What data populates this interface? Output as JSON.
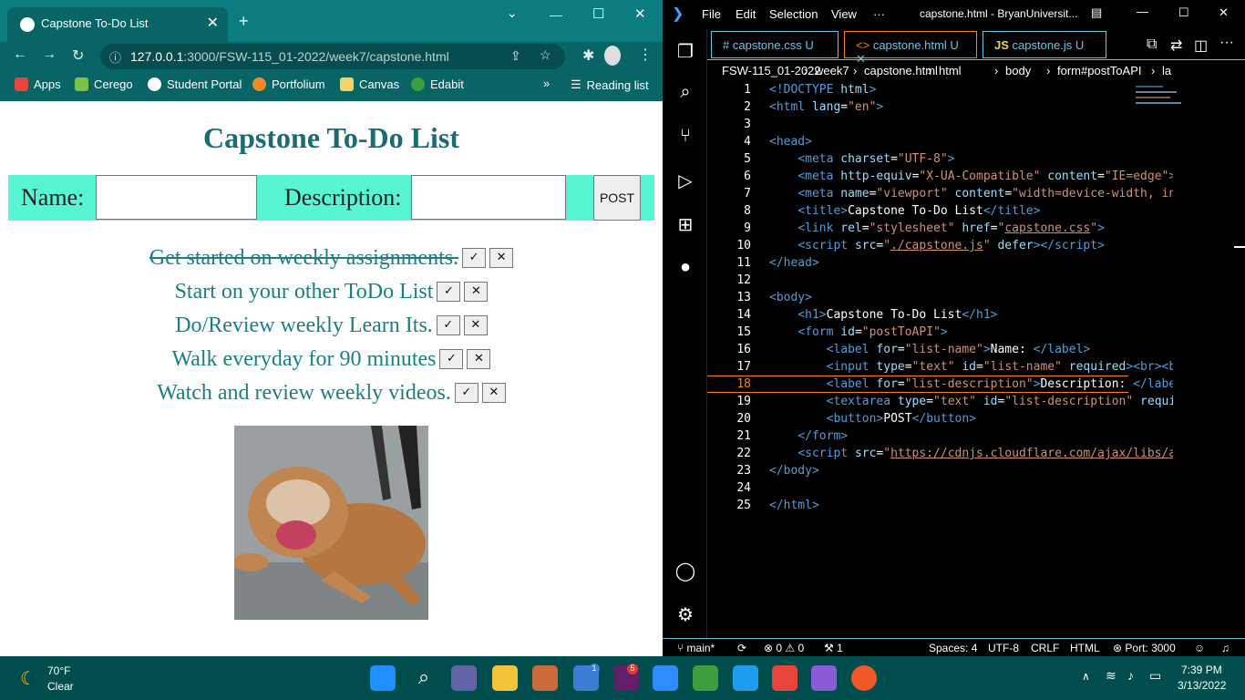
{
  "browser": {
    "tab_title": "Capstone To-Do List",
    "url_host": "127.0.0.1",
    "url_rest": ":3000/FSW-115_01-2022/week7/capstone.html",
    "bookmarks": [
      "Apps",
      "Cerego",
      "Student Portal",
      "Portfolium",
      "Canvas",
      "Edabit"
    ],
    "reading_list": "Reading list"
  },
  "page": {
    "title": "Capstone To-Do List",
    "name_label": "Name:",
    "desc_label": "Description:",
    "post_label": "POST",
    "check_glyph": "✓",
    "delete_glyph": "✕",
    "items": [
      {
        "text": "Get started on weekly assignments.",
        "done": true
      },
      {
        "text": "Start on your other ToDo List",
        "done": false
      },
      {
        "text": "Do/Review weekly Learn Its.",
        "done": false
      },
      {
        "text": "Walk everyday for 90 minutes",
        "done": false
      },
      {
        "text": "Watch and review weekly videos.",
        "done": false
      }
    ]
  },
  "vscode": {
    "menu": [
      "File",
      "Edit",
      "Selection",
      "View",
      "···"
    ],
    "window_title": "capstone.html - BryanUniversit...",
    "tabs": [
      {
        "icon": "#",
        "name": "capstone.css",
        "badge": "U"
      },
      {
        "icon": "<>",
        "name": "capstone.html",
        "badge": "U"
      },
      {
        "icon": "JS",
        "name": "capstone.js",
        "badge": "U"
      }
    ],
    "breadcrumbs": [
      "FSW-115_01-2022",
      "week7",
      "capstone.html",
      "html",
      "body",
      "form#postToAPI",
      "la"
    ],
    "current_line": 18,
    "status": {
      "branch": "main*",
      "errors": "0",
      "warnings": "0",
      "ports_count": "1",
      "spaces": "Spaces: 4",
      "encoding": "UTF-8",
      "eol": "CRLF",
      "language": "HTML",
      "port": "Port: 3000"
    }
  },
  "taskbar": {
    "weather_temp": "70°F",
    "weather_cond": "Clear",
    "time": "7:39 PM",
    "date": "3/13/2022",
    "badge_teams": "1",
    "badge_slack": "5"
  },
  "colors": {
    "accent": "#1d6b72",
    "form_bg": "#58f5d2",
    "hc_border": "#6fc3df",
    "active_tab": "#f38518"
  }
}
